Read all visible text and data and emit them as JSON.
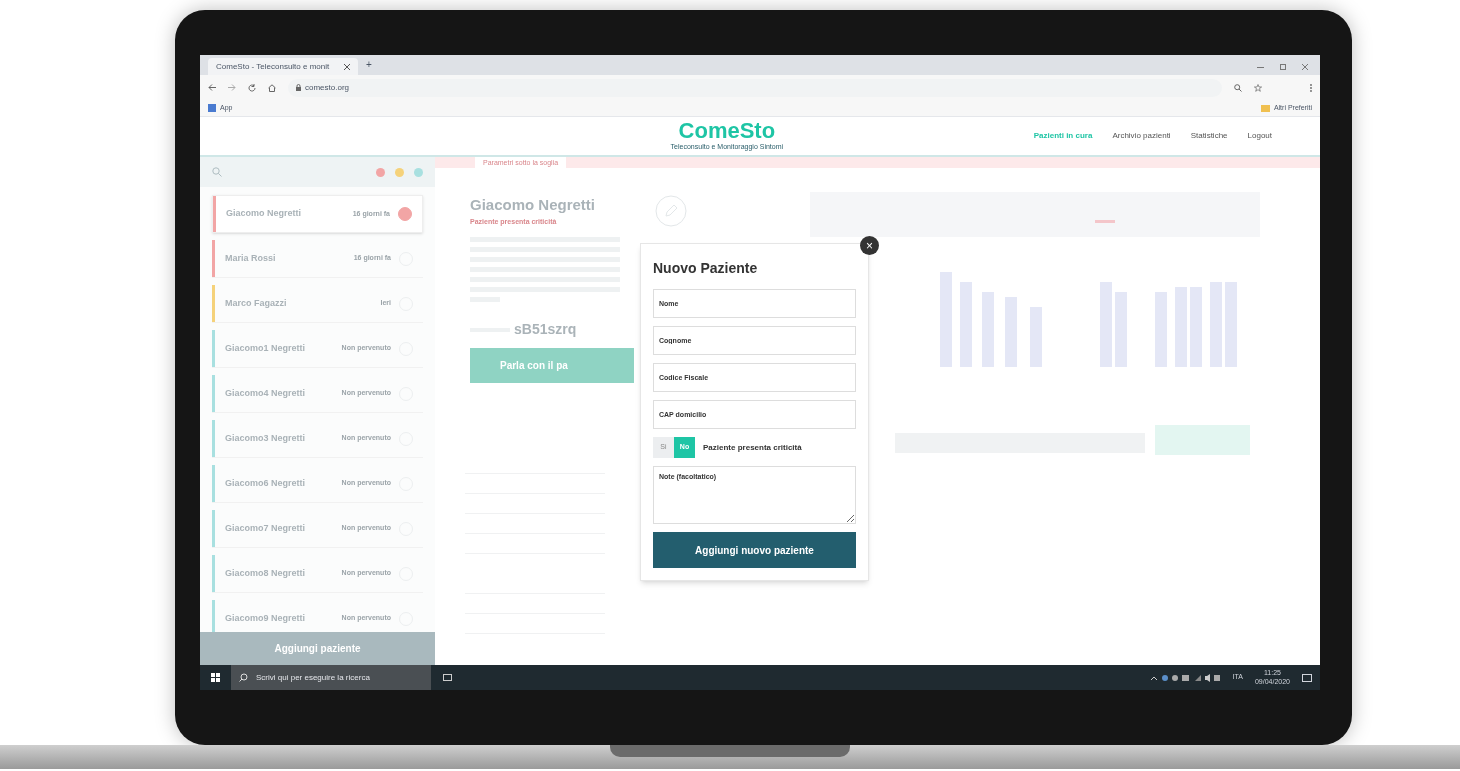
{
  "browser": {
    "tab_title": "ComeSto - Teleconsulto e monit",
    "new_tab": "+",
    "url": "comesto.org",
    "bookmarks": [
      "App"
    ],
    "other_bookmarks": "Altri Preferiti"
  },
  "header": {
    "logo": "ComeSto",
    "tagline": "Teleconsulto e Monitoraggio Sintomi",
    "nav": [
      {
        "label": "Pazienti in cura",
        "selected": true
      },
      {
        "label": "Archivio pazienti",
        "selected": false
      },
      {
        "label": "Statistiche",
        "selected": false
      },
      {
        "label": "Logout",
        "selected": false
      }
    ]
  },
  "sidebar": {
    "pins": [
      {
        "color": "#f2a5a5"
      },
      {
        "color": "#f5d27a"
      },
      {
        "color": "#a8e0e0"
      }
    ],
    "patients": [
      {
        "name": "Giacomo Negretti",
        "status": "16 giorni fa",
        "color": "#f2a5a5",
        "selected": true
      },
      {
        "name": "Maria Rossi",
        "status": "16 giorni fa",
        "color": "#f2a5a5",
        "selected": false
      },
      {
        "name": "Marco Fagazzi",
        "status": "Ieri",
        "color": "#f5d27a",
        "selected": false
      },
      {
        "name": "Giacomo1 Negretti",
        "status": "Non pervenuto",
        "color": "#a8e0e0",
        "selected": false
      },
      {
        "name": "Giacomo4 Negretti",
        "status": "Non pervenuto",
        "color": "#a8e0e0",
        "selected": false
      },
      {
        "name": "Giacomo3 Negretti",
        "status": "Non pervenuto",
        "color": "#a8e0e0",
        "selected": false
      },
      {
        "name": "Giacomo6 Negretti",
        "status": "Non pervenuto",
        "color": "#a8e0e0",
        "selected": false
      },
      {
        "name": "Giacomo7 Negretti",
        "status": "Non pervenuto",
        "color": "#a8e0e0",
        "selected": false
      },
      {
        "name": "Giacomo8 Negretti",
        "status": "Non pervenuto",
        "color": "#a8e0e0",
        "selected": false
      },
      {
        "name": "Giacomo9 Negretti",
        "status": "Non pervenuto",
        "color": "#a8e0e0",
        "selected": false
      }
    ],
    "add_button": "Aggiungi paziente"
  },
  "main": {
    "banner": "Parametri sotto la soglia",
    "patient_name": "Giacomo Negretti",
    "subtitle": "Paziente presenta criticità",
    "code": "sB51szrq",
    "talk_button": "Parla con il pa"
  },
  "modal": {
    "title": "Nuovo Paziente",
    "close": "×",
    "fields": [
      {
        "placeholder": "Nome"
      },
      {
        "placeholder": "Cognome"
      },
      {
        "placeholder": "Codice Fiscale"
      },
      {
        "placeholder": "CAP domicilio"
      }
    ],
    "toggle": [
      {
        "label": "Sì",
        "selected": false
      },
      {
        "label": "No",
        "selected": true
      }
    ],
    "toggle_label": "Paziente presenta criticità",
    "notes": {
      "placeholder": "Note (facoltatico)"
    },
    "submit": "Aggiungi nuovo paziente"
  },
  "taskbar": {
    "search": {
      "placeholder": "Scrivi qui per eseguire la ricerca"
    },
    "language": "ITA",
    "time": "11:25",
    "date": "09/04/2020"
  }
}
